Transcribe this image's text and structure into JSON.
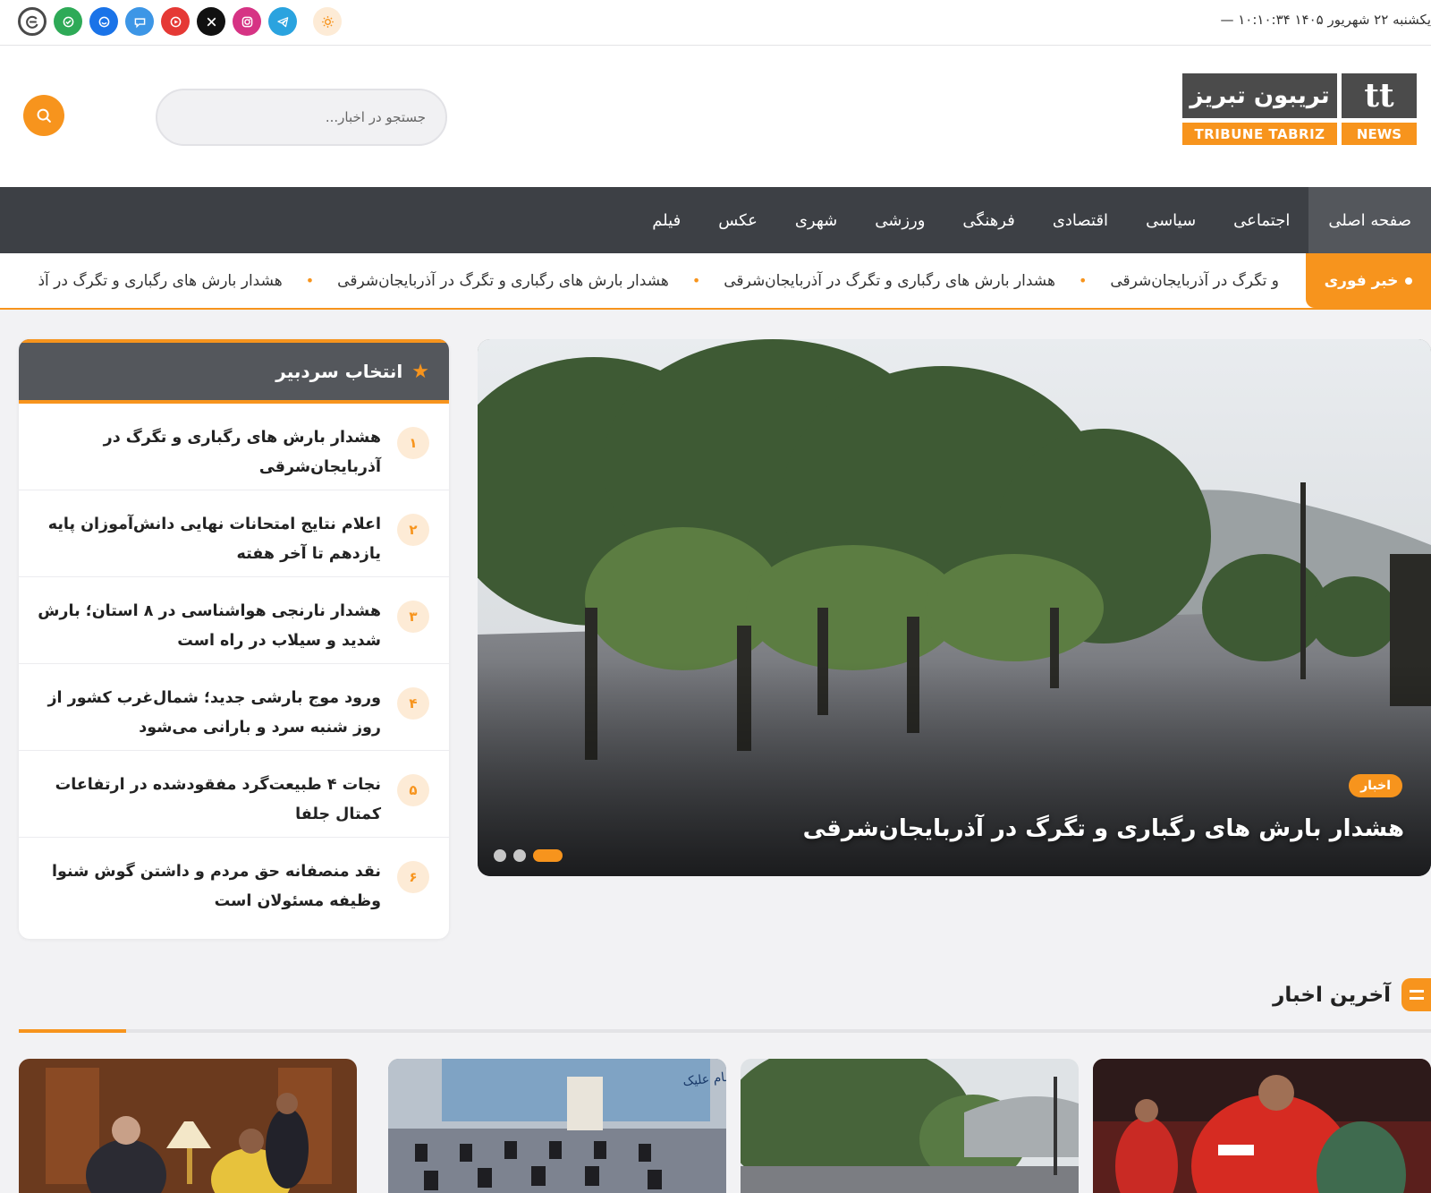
{
  "topbar": {
    "date": "یکشنبه ۲۲ شهریور ۱۴۰۵ ۱۰:۱۰:۳۴ —",
    "socials": [
      {
        "name": "eitaa-icon",
        "color": "#4a4a4a"
      },
      {
        "name": "bale-icon",
        "color": "#2eaa57"
      },
      {
        "name": "rubika-icon",
        "color": "#1a73e8"
      },
      {
        "name": "soroush-icon",
        "color": "#3d96e6"
      },
      {
        "name": "aparat-icon",
        "color": "#e53935"
      },
      {
        "name": "x-icon",
        "color": "#111111"
      },
      {
        "name": "instagram-icon",
        "color": "#d63384"
      },
      {
        "name": "telegram-icon",
        "color": "#2aa3df"
      }
    ],
    "theme_toggle": "sun-icon"
  },
  "logo": {
    "fa_text": "تریبون تبریز",
    "mark": "tt",
    "en_text": "TRIBUNE TABRIZ",
    "badge": "NEWS"
  },
  "search": {
    "placeholder": "جستجو در اخبار..."
  },
  "nav": [
    {
      "label": "صفحه اصلی",
      "active": true
    },
    {
      "label": "اجتماعی"
    },
    {
      "label": "سیاسی"
    },
    {
      "label": "اقتصادی"
    },
    {
      "label": "فرهنگی"
    },
    {
      "label": "ورزشی"
    },
    {
      "label": "شهری"
    },
    {
      "label": "عکس"
    },
    {
      "label": "فیلم"
    }
  ],
  "ticker": {
    "label": "خبر فوری",
    "items": [
      "و تگرگ در آذربایجان‌شرقی",
      "هشدار بارش های رگباری و تگرگ در آذربایجان‌شرقی",
      "هشدار بارش های رگباری و تگرگ در آذربایجان‌شرقی",
      "هشدار بارش های رگباری و تگرگ در آذ"
    ]
  },
  "hero": {
    "tag": "اخبار",
    "title": "هشدار بارش های رگباری و تگرگ در آذربایجان‌شرقی"
  },
  "editor_pick": {
    "title": "انتخاب سردبیر",
    "items": [
      {
        "num": "۱",
        "title": "هشدار بارش های رگباری و تگرگ در آذربایجان‌شرقی"
      },
      {
        "num": "۲",
        "title": "اعلام نتایج امتحانات نهایی دانش‌آموزان پایه یازدهم تا آخر هفته"
      },
      {
        "num": "۳",
        "title": "هشدار نارنجی هواشناسی در ۸ استان؛ بارش شدید و سیلاب در راه است"
      },
      {
        "num": "۴",
        "title": "ورود موج بارشی جدید؛ شمال‌غرب کشور از روز شنبه سرد و بارانی می‌شود"
      },
      {
        "num": "۵",
        "title": "نجات ۴ طبیعت‌گرد مفقودشده در ارتفاعات کمتال جلفا"
      },
      {
        "num": "۶",
        "title": "نقد منصفانه حق مردم و داشتن گوش شنوا وظیفه مسئولان است"
      }
    ]
  },
  "latest": {
    "title": "آخرین اخبار"
  }
}
